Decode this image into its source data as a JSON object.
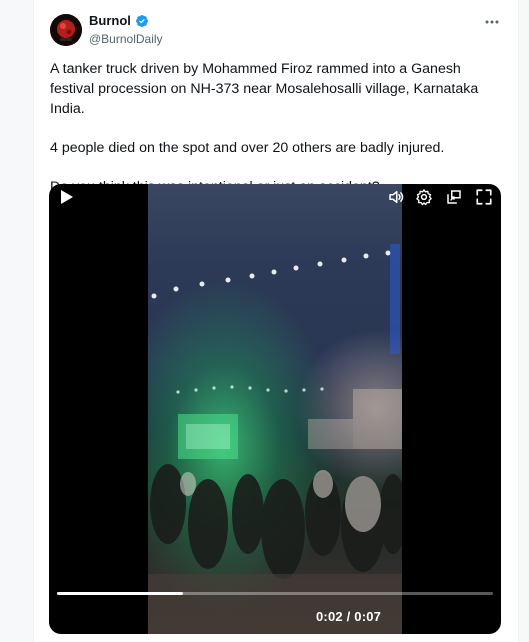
{
  "author": {
    "name": "Burnol",
    "handle": "@BurnolDaily",
    "verified": true
  },
  "post": {
    "paragraphs": [
      "A tanker truck driven by Mohammed Firoz rammed into a Ganesh festival procession on NH-373 near Mosalehosalli village, Karnataka India.",
      "4 people died on the spot and over 20 others are badly injured.",
      "Do you think this was intentional or just an accident?"
    ]
  },
  "video": {
    "current_time": "0:02",
    "duration": "0:07",
    "time_separator": " / ",
    "progress_fraction": 0.29
  },
  "icons": {
    "more": "more-horizontal-icon",
    "verified": "verified-badge-icon",
    "play": "play-icon",
    "volume": "volume-icon",
    "settings": "gear-icon",
    "pip": "picture-in-picture-icon",
    "fullscreen": "fullscreen-icon"
  },
  "colors": {
    "verified": "#1d9bf0",
    "text": "#0f1419",
    "secondary": "#536471"
  }
}
